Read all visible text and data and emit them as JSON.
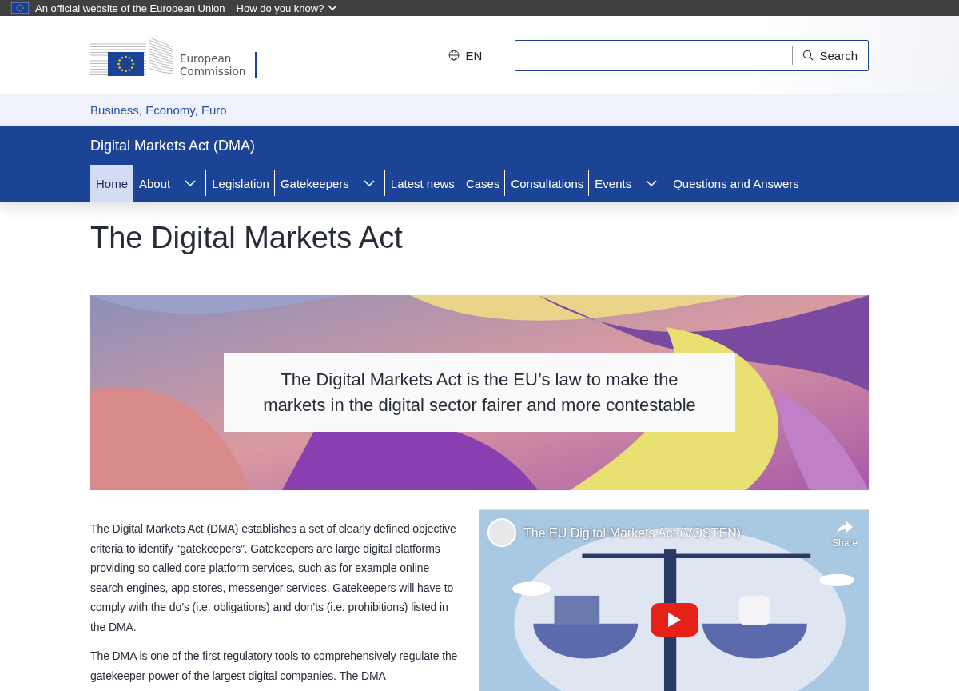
{
  "official_bar": {
    "text": "An official website of the European Union",
    "link": "How do you know?"
  },
  "header": {
    "logo_text": [
      "European",
      "Commission"
    ],
    "language": "EN",
    "search": {
      "button": "Search"
    }
  },
  "breadcrumb": "Business, Economy, Euro",
  "site_title": "Digital Markets Act (DMA)",
  "nav": [
    {
      "label": "Home",
      "selected": true,
      "dropdown": false
    },
    {
      "label": "About",
      "selected": false,
      "dropdown": true
    },
    {
      "label": "Legislation",
      "selected": false,
      "dropdown": false
    },
    {
      "label": "Gatekeepers",
      "selected": false,
      "dropdown": true
    },
    {
      "label": "Latest news",
      "selected": false,
      "dropdown": false
    },
    {
      "label": "Cases",
      "selected": false,
      "dropdown": false
    },
    {
      "label": "Consultations",
      "selected": false,
      "dropdown": false
    },
    {
      "label": "Events",
      "selected": false,
      "dropdown": true
    },
    {
      "label": "Questions and Answers",
      "selected": false,
      "dropdown": false
    }
  ],
  "page_title": "The Digital Markets Act",
  "banner": {
    "kind": "picture",
    "caption": "The Digital Markets Act is the EU’s law to make the markets in the digital sector fairer and more contestable"
  },
  "paragraphs": [
    "The Digital Markets Act (DMA) establishes a set of clearly defined objective criteria to identify “gatekeepers”. Gatekeepers are large digital platforms providing so called core platform services, such as for example online search engines, app stores, messenger services. Gatekeepers will have to comply with the do’s (i.e. obligations) and don’ts (i.e. prohibitions) listed in the DMA.",
    "The DMA is one of the first regulatory tools to comprehensively regulate the gatekeeper power of the largest digital companies. The DMA"
  ],
  "video": {
    "kind": "picture",
    "title": "The EU Digital Markets Act (VOSTEN)",
    "share": "Share"
  }
}
